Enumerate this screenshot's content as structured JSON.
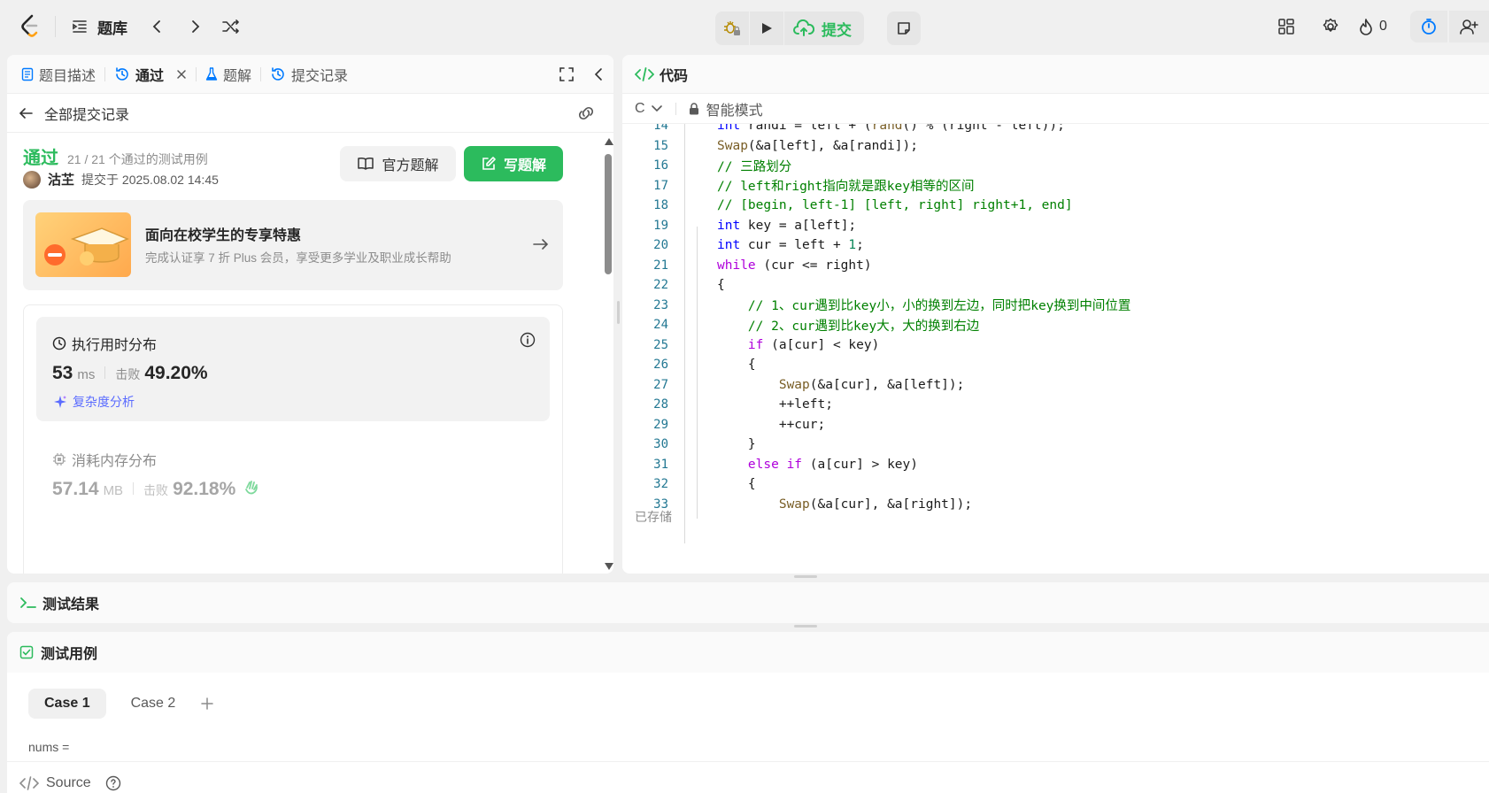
{
  "topnav": {
    "problem_list_label": "题库",
    "submit_label": "提交",
    "streak_count": "0"
  },
  "left": {
    "tabs": [
      {
        "label": "题目描述"
      },
      {
        "label": "通过"
      },
      {
        "label": "题解"
      },
      {
        "label": "提交记录"
      }
    ],
    "back_label": "全部提交记录",
    "status": "通过",
    "cases_text": "21 / 21 个通过的测试用例",
    "author": "沽芏",
    "submitted_at": "提交于 2025.08.02 14:45",
    "official_solution_label": "官方题解",
    "write_solution_label": "写题解",
    "promo": {
      "title": "面向在校学生的专享特惠",
      "subtitle": "完成认证享 7 折 Plus 会员，享受更多学业及职业成长帮助"
    },
    "runtime": {
      "title": "执行用时分布",
      "value": "53",
      "unit": "ms",
      "beat_label": "击败",
      "beat_value": "49.20%",
      "complexity_label": "复杂度分析"
    },
    "memory": {
      "title": "消耗内存分布",
      "value": "57.14",
      "unit": "MB",
      "beat_label": "击败",
      "beat_value": "92.18%"
    }
  },
  "right": {
    "title": "代码",
    "language": "C",
    "mode_label": "智能模式",
    "saved_label": "已存储",
    "code_lines": [
      {
        "n": "14",
        "text": "    int randi = left + (rand() % (right - left));"
      },
      {
        "n": "15",
        "text": "    Swap(&a[left], &a[randi]);"
      },
      {
        "n": "16",
        "text": "    // 三路划分"
      },
      {
        "n": "17",
        "text": "    // left和right指向就是跟key相等的区间"
      },
      {
        "n": "18",
        "text": "    // [begin, left-1] [left, right] right+1, end]"
      },
      {
        "n": "19",
        "text": "    int key = a[left];"
      },
      {
        "n": "20",
        "text": "    int cur = left + 1;"
      },
      {
        "n": "21",
        "text": "    while (cur <= right)"
      },
      {
        "n": "22",
        "text": "    {"
      },
      {
        "n": "23",
        "text": "        // 1、cur遇到比key小，小的换到左边，同时把key换到中间位置"
      },
      {
        "n": "24",
        "text": "        // 2、cur遇到比key大，大的换到右边"
      },
      {
        "n": "25",
        "text": "        if (a[cur] < key)"
      },
      {
        "n": "26",
        "text": "        {"
      },
      {
        "n": "27",
        "text": "            Swap(&a[cur], &a[left]);"
      },
      {
        "n": "28",
        "text": "            ++left;"
      },
      {
        "n": "29",
        "text": "            ++cur;"
      },
      {
        "n": "30",
        "text": "        }"
      },
      {
        "n": "31",
        "text": "        else if (a[cur] > key)"
      },
      {
        "n": "32",
        "text": "        {"
      },
      {
        "n": "33",
        "text": "            Swap(&a[cur], &a[right]);"
      }
    ]
  },
  "bottom": {
    "result_title": "测试结果",
    "cases_title": "测试用例",
    "case_tabs": [
      {
        "label": "Case 1"
      },
      {
        "label": "Case 2"
      }
    ],
    "param_label": "nums =",
    "source_label": "Source"
  },
  "colors": {
    "accent_green": "#2cbb5d",
    "accent_blue": "#007aff",
    "status_green": "#2cbb5d"
  }
}
